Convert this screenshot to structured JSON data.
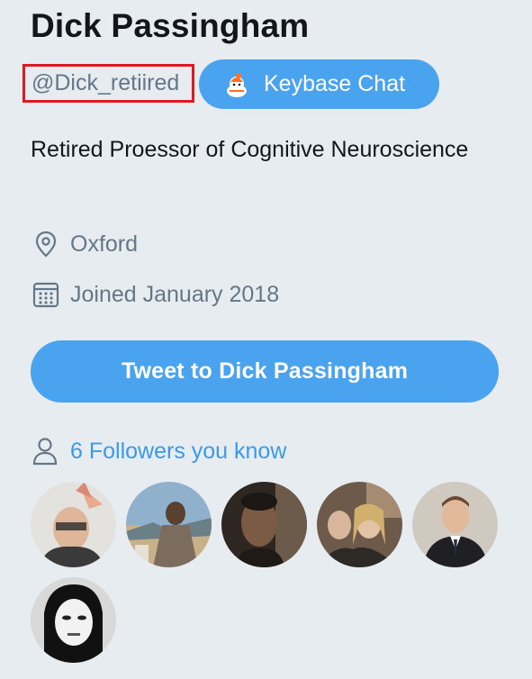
{
  "profile": {
    "name": "Dick Passingham",
    "handle": "@Dick_retiired",
    "bio": "Retired Proessor of Cognitive Neuroscience",
    "location": "Oxford",
    "joined": "Joined January 2018"
  },
  "keybase": {
    "label": "Keybase Chat",
    "icon": "keybase-icon"
  },
  "actions": {
    "tweet_label": "Tweet to Dick Passingham"
  },
  "followers": {
    "label": "6 Followers you know",
    "icon": "person-icon"
  },
  "icons": {
    "location": "location-pin-icon",
    "joined": "calendar-icon"
  },
  "colors": {
    "background": "#e6ecf0",
    "accent": "#4aa3ef",
    "link": "#3a9ae8",
    "secondary_text": "#657786",
    "highlight_box": "#e0191f"
  }
}
